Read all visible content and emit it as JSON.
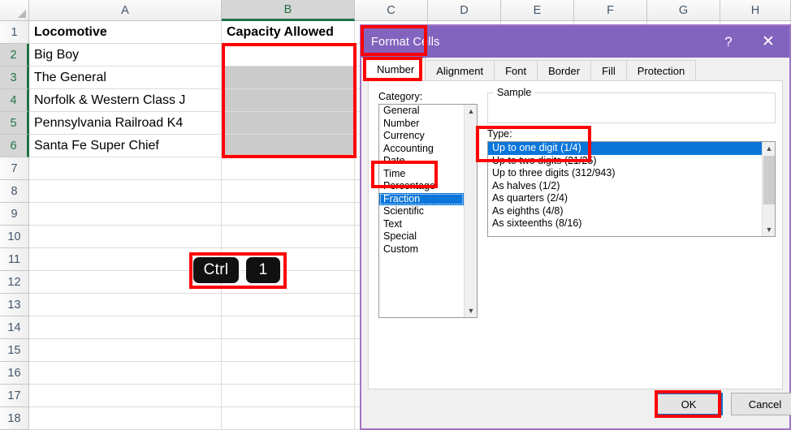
{
  "spreadsheet": {
    "columns": [
      "A",
      "B",
      "C",
      "D",
      "E",
      "F",
      "G",
      "H"
    ],
    "selected_column": "B",
    "rows": [
      "1",
      "2",
      "3",
      "4",
      "5",
      "6",
      "7",
      "8",
      "9",
      "10",
      "11",
      "12",
      "13",
      "14",
      "15",
      "16",
      "17",
      "18"
    ],
    "selected_rows": [
      "2",
      "3",
      "4",
      "5",
      "6"
    ],
    "cells": {
      "A1": "Locomotive",
      "B1": "Capacity Allowed",
      "A2": "Big Boy",
      "A3": "The General",
      "A4": "Norfolk & Western Class J",
      "A5": "Pennsylvania Railroad K4",
      "A6": "Santa Fe Super Chief"
    },
    "selection_range": "B2:B6",
    "active_cell": "B2",
    "selection_color": "#217346"
  },
  "shortcut": {
    "keys": [
      "Ctrl",
      "1"
    ]
  },
  "dialog": {
    "title": "Format Cells",
    "help_icon": "?",
    "close_icon": "✕",
    "titlebar_color": "#8264be",
    "tabs": [
      {
        "label": "Number",
        "active": true
      },
      {
        "label": "Alignment",
        "active": false
      },
      {
        "label": "Font",
        "active": false
      },
      {
        "label": "Border",
        "active": false
      },
      {
        "label": "Fill",
        "active": false
      },
      {
        "label": "Protection",
        "active": false
      }
    ],
    "category": {
      "label": "Category:",
      "items": [
        "General",
        "Number",
        "Currency",
        "Accounting",
        "Date",
        "Time",
        "Percentage",
        "Fraction",
        "Scientific",
        "Text",
        "Special",
        "Custom"
      ],
      "selected": "Fraction"
    },
    "sample": {
      "label": "Sample",
      "value": ""
    },
    "type": {
      "label": "Type:",
      "items": [
        "Up to one digit (1/4)",
        "Up to two digits (21/25)",
        "Up to three digits (312/943)",
        "As halves (1/2)",
        "As quarters (2/4)",
        "As eighths (4/8)",
        "As sixteenths (8/16)"
      ],
      "selected": "Up to one digit (1/4)"
    },
    "buttons": {
      "ok": "OK",
      "cancel": "Cancel"
    },
    "scroll_icons": {
      "up": "▲",
      "down": "▼"
    }
  },
  "annotations": {
    "highlight_color": "#ff0000"
  }
}
